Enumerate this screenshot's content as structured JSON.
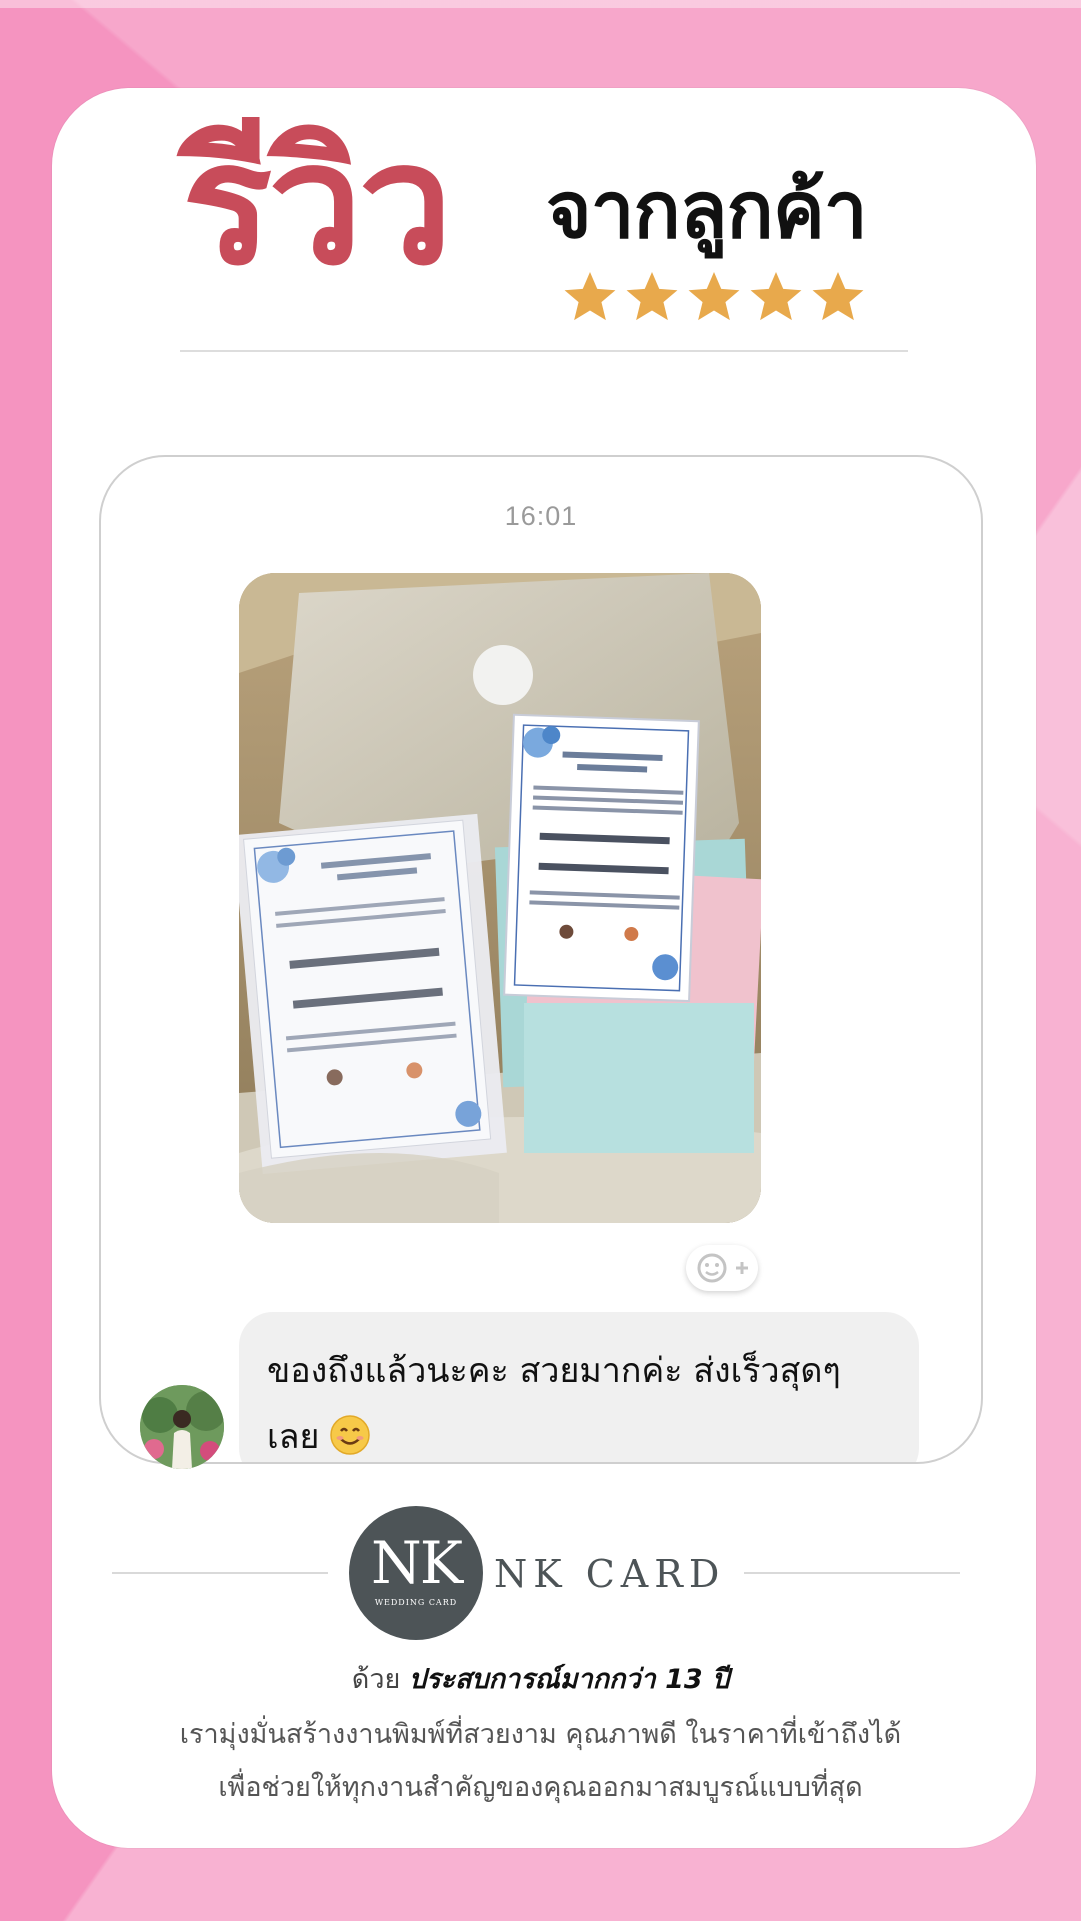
{
  "header": {
    "title_main": "รีวิว",
    "title_sub": "จากลูกค้า",
    "rating": 5,
    "star_color": "#E8A94C",
    "title_color": "#C84C5A"
  },
  "chat": {
    "timestamp": "16:01",
    "photo_icon": "photo-of-wedding-invitation-cards",
    "reaction_icon": "add-reaction-icon",
    "message": "ของถึงแล้วนะคะ สวยมากค่ะ ส่งเร็วสุดๆ เลย",
    "message_emoji": "smiling-face-emoji"
  },
  "brand": {
    "logo_mark": "NK",
    "logo_subtitle": "WEDDING CARD",
    "name": "NK CARD",
    "tagline_prefix": "ด้วย",
    "tagline_emphasis": "ประสบการณ์มากกว่า 13 ปี",
    "description_line1": "เรามุ่งมั่นสร้างงานพิมพ์ที่สวยงาม คุณภาพดี ในราคาที่เข้าถึงได้",
    "description_line2": "เพื่อช่วยให้ทุกงานสำคัญของคุณออกมาสมบูรณ์แบบที่สุด",
    "logo_color": "#4D5457"
  },
  "background": {
    "pink": "#F594C0",
    "card": "#FFFFFF"
  }
}
